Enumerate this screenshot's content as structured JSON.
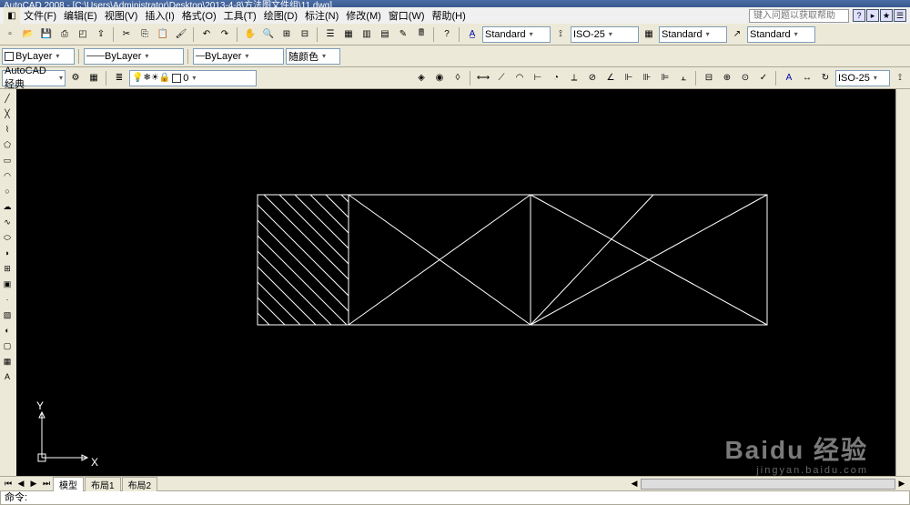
{
  "titlebar": {
    "text": "AutoCAD 2008 - [C:\\Users\\Administrator\\Desktop\\2013-4-8\\方法图文件组\\11.dwg]"
  },
  "menu": {
    "file": "文件(F)",
    "edit": "编辑(E)",
    "view": "视图(V)",
    "insert": "插入(I)",
    "format": "格式(O)",
    "tools": "工具(T)",
    "draw": "绘图(D)",
    "dimension": "标注(N)",
    "modify": "修改(M)",
    "window": "窗口(W)",
    "help": "帮助(H)",
    "search_placeholder": "键入问题以获取帮助"
  },
  "props": {
    "bylayer1": "ByLayer",
    "bylayer2": "ByLayer",
    "bylayer3": "ByLayer",
    "bycolor": "随颜色",
    "standard": "Standard",
    "iso25": "ISO-25",
    "standard2": "Standard",
    "standard3": "Standard"
  },
  "workspace": {
    "name": "AutoCAD 经典",
    "layer": "0",
    "dimstyle": "ISO-25"
  },
  "tabs": {
    "model": "模型",
    "layout1": "布局1",
    "layout2": "布局2"
  },
  "cmd": {
    "prompt": "命令:"
  },
  "ucs": {
    "x": "X",
    "y": "Y"
  },
  "watermark": {
    "main": "Baidu 经验",
    "sub": "jingyan.baidu.com"
  }
}
